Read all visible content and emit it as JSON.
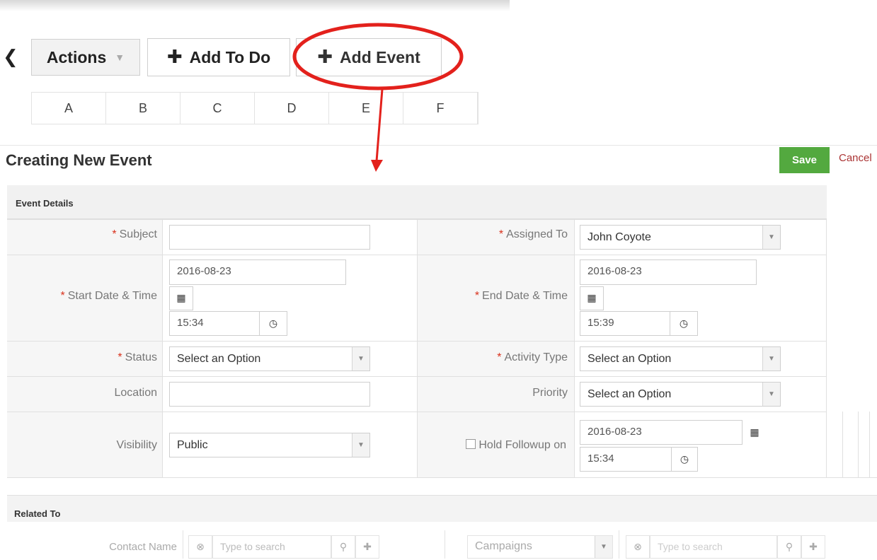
{
  "toolbar": {
    "back_glyph": "❮",
    "actions_label": "Actions",
    "add_todo_label": "Add To Do",
    "add_event_label": "Add Event"
  },
  "alphabet": [
    "A",
    "B",
    "C",
    "D",
    "E",
    "F"
  ],
  "form": {
    "title": "Creating New Event",
    "save_label": "Save",
    "cancel_label": "Cancel",
    "section_label": "Event Details",
    "subject": {
      "label": "Subject",
      "value": ""
    },
    "assigned_to": {
      "label": "Assigned To",
      "value": "John Coyote"
    },
    "start": {
      "label": "Start Date & Time",
      "date": "2016-08-23",
      "time": "15:34"
    },
    "end": {
      "label": "End Date & Time",
      "date": "2016-08-23",
      "time": "15:39"
    },
    "status": {
      "label": "Status",
      "value": "Select an Option"
    },
    "activity_type": {
      "label": "Activity Type",
      "value": "Select an Option"
    },
    "location": {
      "label": "Location",
      "value": ""
    },
    "priority": {
      "label": "Priority",
      "value": "Select an Option"
    },
    "visibility": {
      "label": "Visibility",
      "value": "Public"
    },
    "hold_followup": {
      "label": "Hold Followup on",
      "date": "2016-08-23",
      "time": "15:34"
    },
    "required_mark": "*"
  },
  "related": {
    "section_label": "Related To",
    "contact_name_label": "Contact Name",
    "search_placeholder": "Type to search",
    "module_value": "Campaigns"
  },
  "colors": {
    "save_green": "#53a93f",
    "required_red": "#d9311c",
    "annotation_red": "#e3211c"
  }
}
